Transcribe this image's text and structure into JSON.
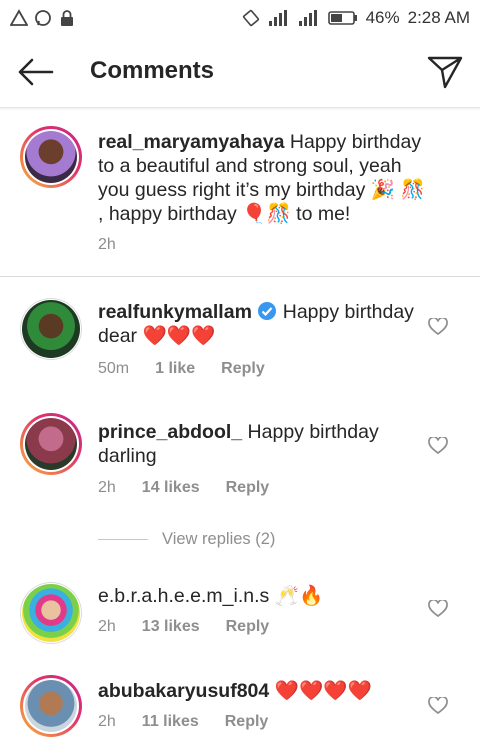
{
  "status_bar": {
    "battery": "46%",
    "time": "2:28 AM"
  },
  "header": {
    "title": "Comments"
  },
  "post": {
    "username": "real_maryamyahaya",
    "text": "Happy birthday to a beautiful and strong soul, yeah you guess right it’s my birthday 🎉 🎊 , happy birthday 🎈🎊 to me!",
    "time": "2h"
  },
  "comments": [
    {
      "username": "realfunkymallam",
      "verified": true,
      "text": "Happy birthday dear ❤️❤️❤️",
      "time": "50m",
      "likes": "1 like",
      "reply": "Reply"
    },
    {
      "username": "prince_abdool_",
      "text": "Happy birthday darling",
      "time": "2h",
      "likes": "14 likes",
      "reply": "Reply",
      "view_replies": "View replies (2)"
    },
    {
      "username": "e.b.r.a.h.e.e.m_i.n.s",
      "text": "🥂🔥",
      "time": "2h",
      "likes": "13 likes",
      "reply": "Reply"
    },
    {
      "username": "abubakaryusuf804",
      "text": "❤️❤️❤️❤️",
      "time": "2h",
      "likes": "11 likes",
      "reply": "Reply"
    }
  ],
  "colors": {
    "accent_ring": "#e2336b",
    "verified": "#3897f0",
    "muted": "#8e8e8e"
  }
}
